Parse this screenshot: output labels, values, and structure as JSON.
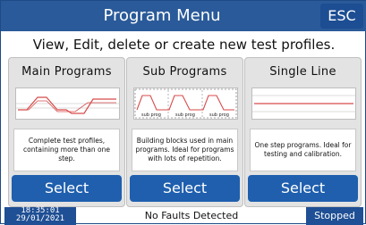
{
  "header": {
    "title": "Program Menu",
    "esc_label": "ESC"
  },
  "subtitle": "View, Edit, delete or create new test profiles.",
  "cards": [
    {
      "title": "Main Programs",
      "description": "Complete test profiles, containing more than one step.",
      "select_label": "Select"
    },
    {
      "title": "Sub Programs",
      "description": "Building blocks used in main programs. Ideal for programs with lots of repetition.",
      "select_label": "Select",
      "graph_labels": [
        "sub prog",
        "sub prog",
        "sub prog"
      ]
    },
    {
      "title": "Single Line",
      "description": "One step programs. Ideal for testing and calibration.",
      "select_label": "Select"
    }
  ],
  "status": {
    "time": "18:35:01",
    "date": "29/01/2021",
    "message": "No Faults Detected",
    "state": "Stopped"
  },
  "colors": {
    "primary": "#2a5a99",
    "button": "#1f5fae",
    "graph_line": "#d84a4a",
    "card_bg": "#e3e3e3"
  }
}
